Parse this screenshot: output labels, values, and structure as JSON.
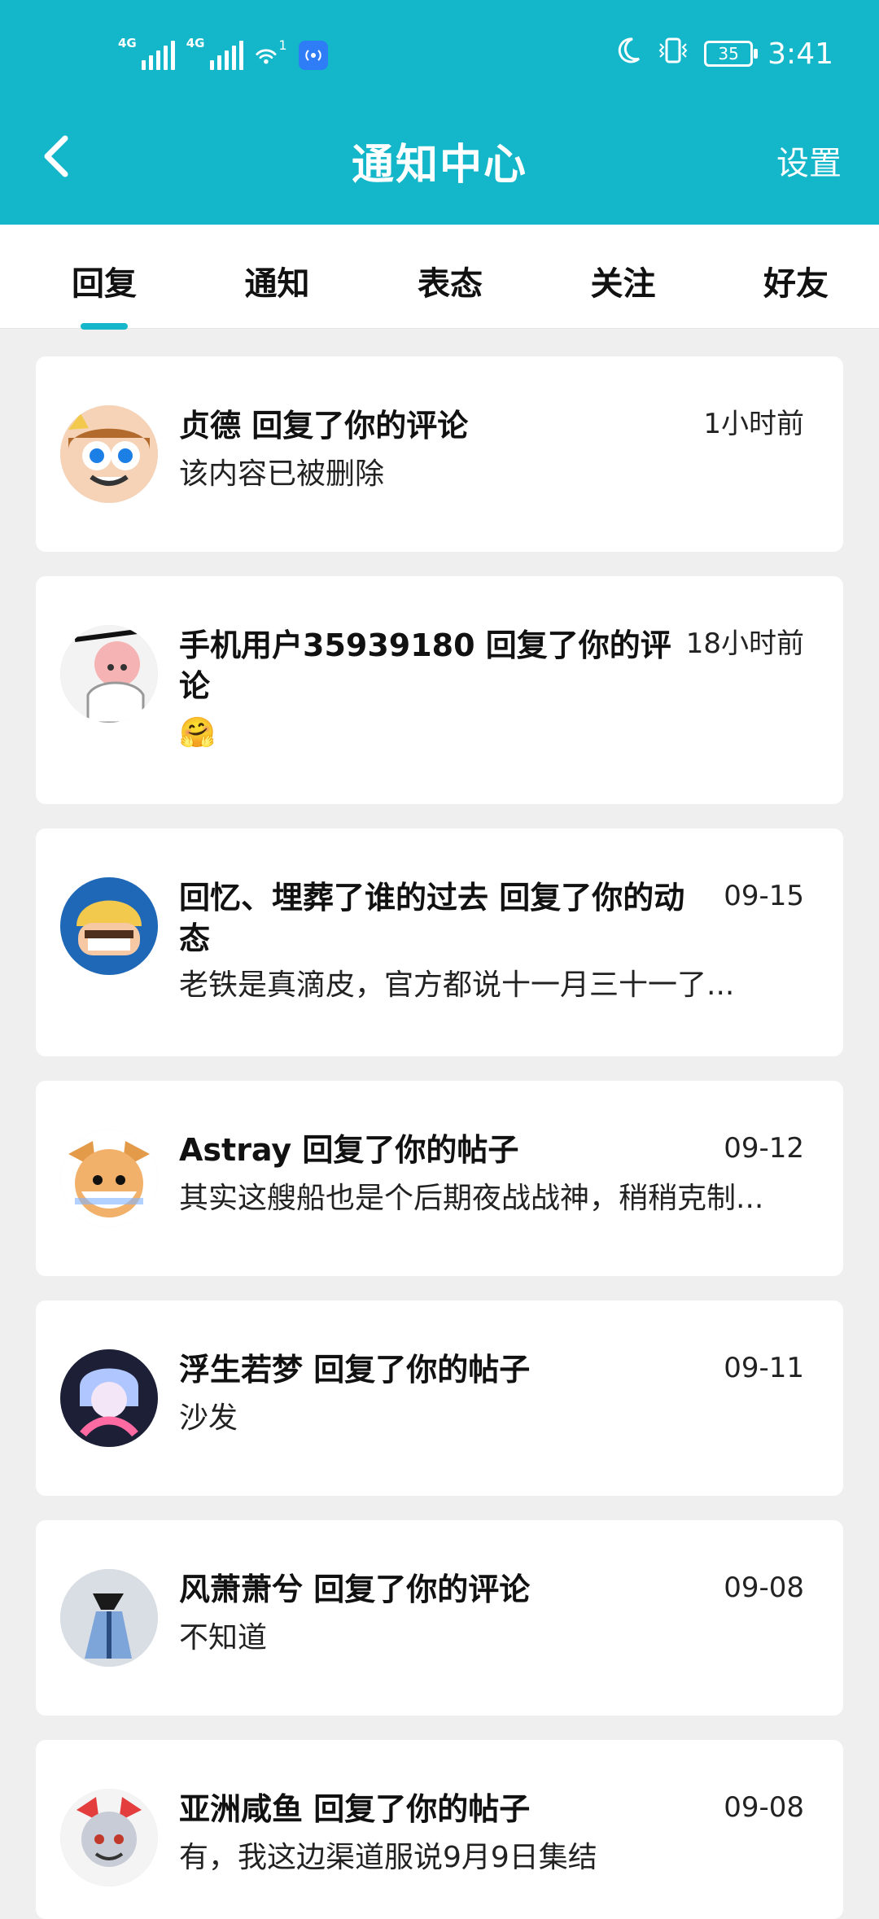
{
  "status_bar": {
    "net1": "4G",
    "net2": "4G",
    "wifi_badge": "1",
    "battery": "35",
    "time": "3:41"
  },
  "header": {
    "title": "通知中心",
    "settings_label": "设置"
  },
  "tabs": [
    {
      "label": "回复",
      "active": true
    },
    {
      "label": "通知"
    },
    {
      "label": "表态"
    },
    {
      "label": "关注"
    },
    {
      "label": "好友"
    }
  ],
  "items": [
    {
      "user_line": "贞德 回复了你的评论",
      "time": "1小时前",
      "content": "该内容已被删除",
      "avatar": "cartoon-face-avatar"
    },
    {
      "user_line": "手机用户35939180 回复了你的评论",
      "time": "18小时前",
      "content": "🤗",
      "avatar": "anime-girl-avatar"
    },
    {
      "user_line": "回忆、埋葬了谁的过去 回复了你的动态",
      "time": "09-15",
      "content": "老铁是真滴皮，官方都说十一月三十一了...",
      "avatar": "barbarian-avatar"
    },
    {
      "user_line": "Astray 回复了你的帖子",
      "time": "09-12",
      "content": "其实这艘船也是个后期夜战战神，稍稍克制...",
      "avatar": "shiba-dog-avatar"
    },
    {
      "user_line": "浮生若梦 回复了你的帖子",
      "time": "09-11",
      "content": "沙发",
      "avatar": "dark-anime-avatar"
    },
    {
      "user_line": "风萧萧兮 回复了你的评论",
      "time": "09-08",
      "content": "不知道",
      "avatar": "ink-warrior-avatar"
    },
    {
      "user_line": "亚洲咸鱼 回复了你的帖子",
      "time": "09-08",
      "content": "有，我这边渠道服说9月9日集结",
      "avatar": "fox-mask-avatar"
    }
  ]
}
